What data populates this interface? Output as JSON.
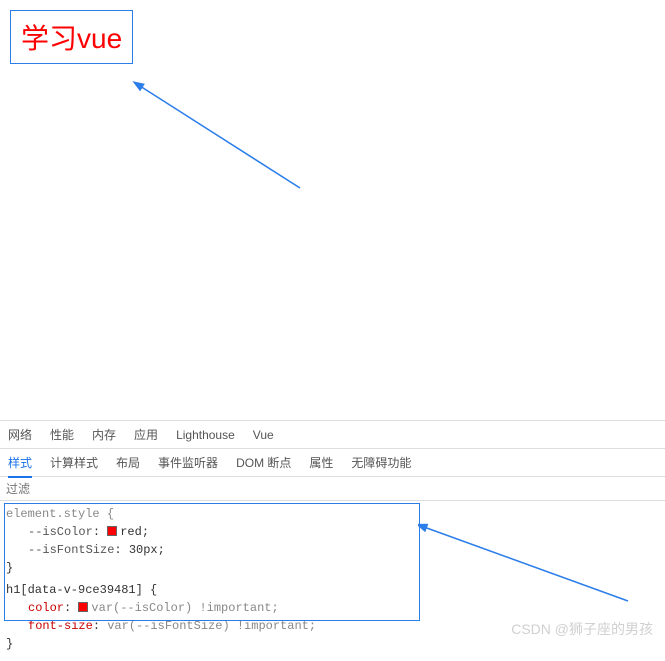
{
  "rendered": {
    "text": "学习vue"
  },
  "devtools": {
    "mainTabs": [
      "网络",
      "性能",
      "内存",
      "应用",
      "Lighthouse",
      "Vue"
    ],
    "subTabs": [
      "样式",
      "计算样式",
      "布局",
      "事件监听器",
      "DOM 断点",
      "属性",
      "无障碍功能"
    ],
    "activeSubTab": "样式",
    "filterPlaceholder": "过滤"
  },
  "styles": {
    "rule1": {
      "selector": "element.style {",
      "prop1_name": "--isColor",
      "prop1_value": "red;",
      "prop2_name": "--isFontSize",
      "prop2_value": "30px;",
      "close": "}"
    },
    "rule2": {
      "selector": "h1[data-v-9ce39481] {",
      "prop1_name": "color",
      "prop1_swatch": true,
      "prop1_var": "var(--isColor)",
      "prop1_imp": "!important;",
      "prop2_name": "font-size",
      "prop2_var": "var(--isFontSize)",
      "prop2_imp": "!important;",
      "close": "}"
    }
  },
  "watermark": "CSDN @狮子座的男孩"
}
